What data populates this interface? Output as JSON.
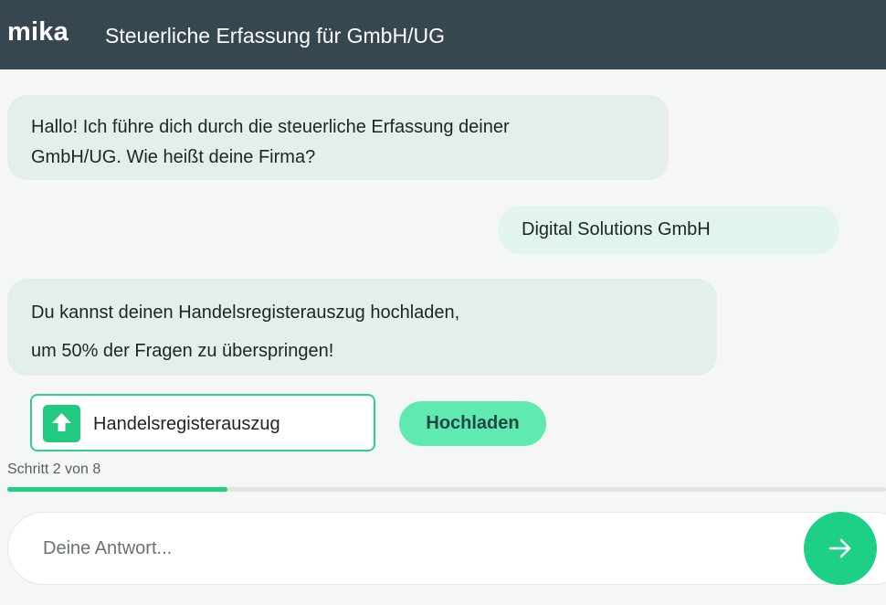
{
  "header": {
    "logo": "mika",
    "title": "Steuerliche Erfassung für GmbH/UG"
  },
  "messages": [
    {
      "role": "bot",
      "lines": [
        "Hallo! Ich führe dich durch die steuerliche Erfassung deiner",
        "GmbH/UG. Wie heißt deine Firma?"
      ]
    },
    {
      "role": "user",
      "lines": [
        "Digital Solutions GmbH"
      ]
    },
    {
      "role": "bot",
      "lines": [
        "Du kannst deinen Handelsregisterauszug hochladen,",
        "um 50% der Fragen zu überspringen!"
      ]
    }
  ],
  "upload": {
    "label": "Handelsregisterauszug",
    "icon": "upload-icon",
    "button_label": "Hochladen"
  },
  "progress": {
    "step_text": "Schritt 2 von 8",
    "current_step": 2,
    "total_steps": 8,
    "fraction": 0.25
  },
  "composer": {
    "placeholder": "Deine Antwort...",
    "value": "",
    "send_icon": "arrow-right-icon"
  },
  "colors": {
    "header_bg": "#36474f",
    "accent": "#1ecf86",
    "bot_bubble": "#e4efe9",
    "user_bubble": "#e2f5ec"
  }
}
